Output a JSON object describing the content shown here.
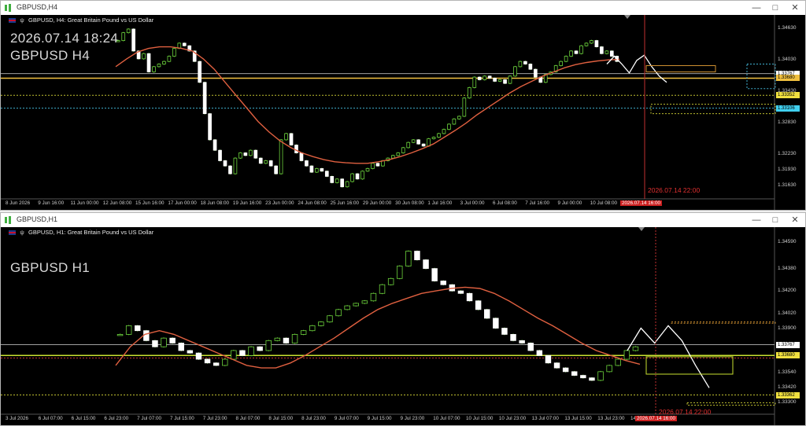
{
  "top": {
    "window_title": "GBPUSD,H4",
    "chart_header": "GBPUSD, H4:  Great Britain Pound vs US Dollar",
    "datetime_text": "2026.07.14 18:24",
    "symbol_text": "GBPUSD H4",
    "y_ticks": [
      "1.34630",
      "1.34030",
      "1.33430",
      "1.32830",
      "1.32230",
      "1.31930",
      "1.31630"
    ],
    "price_labels": [
      {
        "text": "1.33767",
        "color": "#ffffff",
        "key": "a"
      },
      {
        "text": "1.33680",
        "color": "#f0c040",
        "key": "b"
      },
      {
        "text": "1.33352",
        "color": "#f0e040",
        "key": "c"
      },
      {
        "text": "1.33106",
        "color": "#40d0f0",
        "key": "d"
      }
    ],
    "x_ticks": [
      "8 Jun 2026",
      "9 Jun 16:00",
      "11 Jun 00:00",
      "12 Jun 08:00",
      "15 Jun 16:00",
      "17 Jun 00:00",
      "18 Jun 08:00",
      "19 Jun 16:00",
      "23 Jun 00:00",
      "24 Jun 08:00",
      "25 Jun 16:00",
      "29 Jun 00:00",
      "30 Jun 08:00",
      "1 Jul 16:00",
      "3 Jul 00:00",
      "6 Jul 08:00",
      "7 Jul 16:00",
      "9 Jul 00:00",
      "10 Jul 08:00",
      "13"
    ],
    "x_red_label": "2026.07.14 16:00",
    "vline_label": "2026.07.14 22:00",
    "chart_data": {
      "type": "candlestick",
      "ylim": [
        1.314,
        1.348
      ],
      "close_series": [
        1.344,
        1.3455,
        1.3462,
        1.342,
        1.3405,
        1.3415,
        1.338,
        1.339,
        1.3395,
        1.34,
        1.341,
        1.3425,
        1.3435,
        1.343,
        1.342,
        1.34,
        1.336,
        1.33,
        1.325,
        1.323,
        1.321,
        1.32,
        1.3185,
        1.3215,
        1.3225,
        1.322,
        1.323,
        1.3215,
        1.3205,
        1.321,
        1.32,
        1.3185,
        1.325,
        1.3262,
        1.324,
        1.3225,
        1.321,
        1.32,
        1.3188,
        1.3195,
        1.319,
        1.318,
        1.3168,
        1.3175,
        1.316,
        1.317,
        1.3185,
        1.3175,
        1.319,
        1.3195,
        1.3205,
        1.32,
        1.321,
        1.3215,
        1.322,
        1.3225,
        1.3235,
        1.3245,
        1.325,
        1.3242,
        1.3238,
        1.3252,
        1.3255,
        1.3262,
        1.327,
        1.328,
        1.329,
        1.3295,
        1.333,
        1.335,
        1.337,
        1.3365,
        1.3372,
        1.3368,
        1.3362,
        1.3365,
        1.3358,
        1.3372,
        1.339,
        1.34,
        1.3395,
        1.3385,
        1.337,
        1.336,
        1.3375,
        1.338,
        1.3392,
        1.34,
        1.341,
        1.342,
        1.3415,
        1.343,
        1.3435,
        1.344,
        1.3428,
        1.3415,
        1.342,
        1.341,
        1.34
      ],
      "ma_series": [
        1.339,
        1.3405,
        1.3418,
        1.3425,
        1.3428,
        1.3428,
        1.3425,
        1.342,
        1.3405,
        1.3385,
        1.336,
        1.3335,
        1.331,
        1.3285,
        1.3265,
        1.3248,
        1.3235,
        1.3225,
        1.3218,
        1.3212,
        1.3208,
        1.3206,
        1.3205,
        1.3205,
        1.3208,
        1.3212,
        1.3218,
        1.3225,
        1.3233,
        1.3242,
        1.3255,
        1.3268,
        1.3282,
        1.3298,
        1.3312,
        1.3326,
        1.334,
        1.3352,
        1.3362,
        1.3372,
        1.338,
        1.3388,
        1.3394,
        1.3398,
        1.3401,
        1.3403,
        1.3404
      ],
      "forecast_line": [
        1.3395,
        1.341,
        1.3395,
        1.3378,
        1.3402,
        1.3412,
        1.339,
        1.3372,
        1.336
      ]
    }
  },
  "bottom": {
    "window_title": "GBPUSD,H1",
    "chart_header": "GBPUSD, H1:  Great Britain Pound vs US Dollar",
    "symbol_text": "GBPUSD H1",
    "y_ticks": [
      "1.34590",
      "1.34380",
      "1.34200",
      "1.34020",
      "1.33900",
      "1.33540",
      "1.33420",
      "1.33300"
    ],
    "price_labels": [
      {
        "text": "1.33767",
        "color": "#ffffff",
        "key": "a"
      },
      {
        "text": "1.33680",
        "color": "#f0e040",
        "key": "b"
      },
      {
        "text": "1.33362",
        "color": "#f0e040",
        "key": "c"
      }
    ],
    "x_ticks": [
      "3 Jul 2026",
      "6 Jul 07:00",
      "6 Jul 15:00",
      "6 Jul 23:00",
      "7 Jul 07:00",
      "7 Jul 15:00",
      "7 Jul 23:00",
      "8 Jul 07:00",
      "8 Jul 15:00",
      "8 Jul 23:00",
      "9 Jul 07:00",
      "9 Jul 15:00",
      "9 Jul 23:00",
      "10 Jul 07:00",
      "10 Jul 15:00",
      "10 Jul 23:00",
      "13 Jul 07:00",
      "13 Jul 15:00",
      "13 Jul 23:00",
      "14 Jul 0"
    ],
    "x_red_label": "2026.07.14 16:00",
    "vline_label": "2026.07.14 22:00",
    "chart_data": {
      "type": "candlestick",
      "ylim": [
        1.3322,
        1.3465
      ],
      "close_series": [
        1.3385,
        1.3392,
        1.3388,
        1.338,
        1.3375,
        1.3382,
        1.3378,
        1.3372,
        1.337,
        1.3365,
        1.3362,
        1.336,
        1.3365,
        1.3372,
        1.3368,
        1.3375,
        1.3372,
        1.338,
        1.3382,
        1.3378,
        1.3385,
        1.3388,
        1.3392,
        1.3395,
        1.34,
        1.3405,
        1.3408,
        1.341,
        1.3412,
        1.3418,
        1.3425,
        1.343,
        1.344,
        1.3452,
        1.3445,
        1.3438,
        1.3428,
        1.3425,
        1.342,
        1.3418,
        1.3412,
        1.3405,
        1.3398,
        1.339,
        1.3385,
        1.338,
        1.3378,
        1.3372,
        1.3368,
        1.3362,
        1.3358,
        1.3355,
        1.3352,
        1.335,
        1.3348,
        1.3355,
        1.336,
        1.3365,
        1.3372,
        1.3375
      ],
      "ma_series": [
        1.336,
        1.3375,
        1.3385,
        1.3388,
        1.3385,
        1.338,
        1.3375,
        1.337,
        1.3365,
        1.336,
        1.3358,
        1.3358,
        1.3362,
        1.3368,
        1.3375,
        1.3382,
        1.339,
        1.3398,
        1.3405,
        1.341,
        1.3414,
        1.3418,
        1.342,
        1.3422,
        1.3423,
        1.3422,
        1.3418,
        1.3412,
        1.3405,
        1.3398,
        1.3392,
        1.3385,
        1.3378,
        1.3372,
        1.3368,
        1.3364,
        1.3361
      ],
      "forecast_line": [
        1.3372,
        1.339,
        1.3378,
        1.3392,
        1.338,
        1.336,
        1.3342
      ]
    }
  }
}
